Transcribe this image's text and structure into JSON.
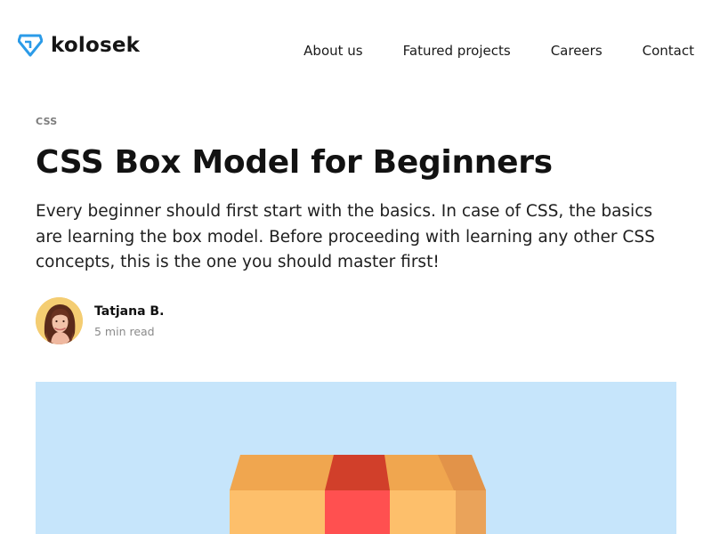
{
  "header": {
    "brand_name": "kolosek",
    "logo_icon": "diamond-icon",
    "nav": [
      {
        "label": "About us"
      },
      {
        "label": "Fatured projects"
      },
      {
        "label": "Careers"
      },
      {
        "label": "Contact"
      }
    ]
  },
  "article": {
    "category": "CSS",
    "title": "CSS Box Model for Beginners",
    "lead": "Every beginner should first start with the basics. In case of CSS, the basics are learning the box model. Before proceeding with learning any other CSS concepts, this is the one you should master first!",
    "author": {
      "name": "Tatjana B.",
      "read_time": "5 min read"
    }
  },
  "colors": {
    "brand_accent": "#2b9be8",
    "hero_background": "#c6e5fb",
    "box_light": "#fdbf6b",
    "box_top": "#f0a64f",
    "box_side": "#e89a4a",
    "tape": "#ff5050",
    "tape_top": "#d13f2a"
  }
}
